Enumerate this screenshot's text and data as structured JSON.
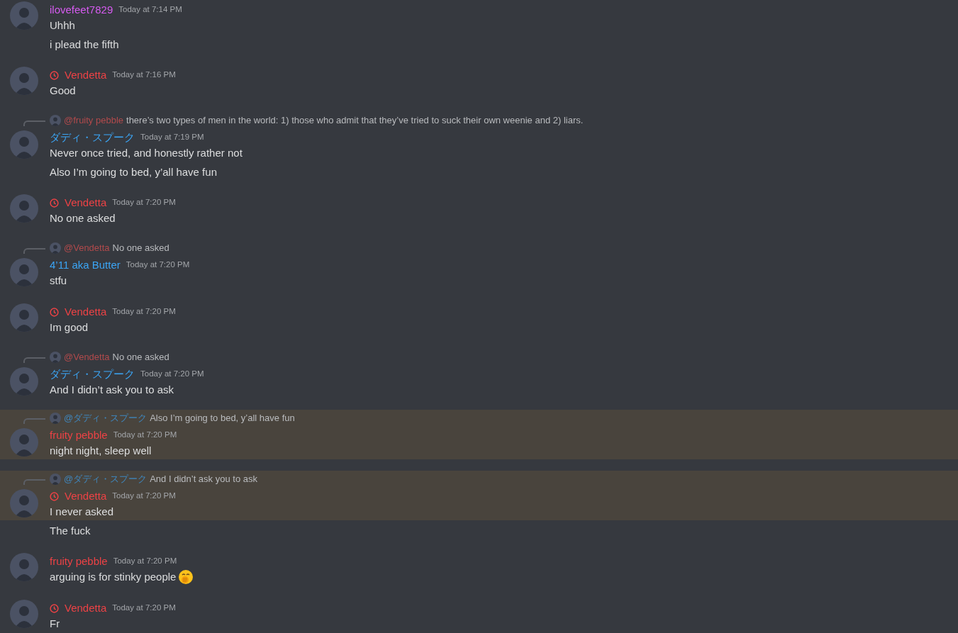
{
  "messages": [
    {
      "author": "ilovefeet7829",
      "color": "#d65bf0",
      "status_icon": false,
      "timestamp": "Today at 7:14 PM",
      "lines": [
        {
          "kind": "text",
          "text": "Uhhh",
          "highlighted": false
        },
        {
          "kind": "text",
          "text": "i plead the fifth",
          "highlighted": false
        }
      ]
    },
    {
      "author": "Vendetta",
      "color": "#ed4245",
      "status_icon": true,
      "timestamp": "Today at 7:16 PM",
      "lines": [
        {
          "kind": "text",
          "text": "Good",
          "highlighted": false
        }
      ]
    },
    {
      "author": "ダディ・スプーク",
      "color": "#3ba5f5",
      "status_icon": false,
      "timestamp": "Today at 7:19 PM",
      "reply": {
        "mention": "@fruity pebble",
        "color": "#b24a4c",
        "text": "there’s two types of men in the world: 1) those who admit that they’ve tried to suck their own weenie and 2) liars."
      },
      "lines": [
        {
          "kind": "text",
          "text": "Never once tried, and honestly rather not",
          "highlighted": false
        },
        {
          "kind": "text",
          "text": "Also I’m going to bed, y’all have fun",
          "highlighted": false
        }
      ]
    },
    {
      "author": "Vendetta",
      "color": "#ed4245",
      "status_icon": true,
      "timestamp": "Today at 7:20 PM",
      "lines": [
        {
          "kind": "text",
          "text": "No one asked",
          "highlighted": false
        }
      ]
    },
    {
      "author": "4’11 aka Butter",
      "color": "#3ba5f5",
      "status_icon": false,
      "timestamp": "Today at 7:20 PM",
      "reply": {
        "mention": "@Vendetta",
        "color": "#b24a4c",
        "text": "No one asked"
      },
      "lines": [
        {
          "kind": "text",
          "text": "stfu",
          "highlighted": false
        }
      ]
    },
    {
      "author": "Vendetta",
      "color": "#ed4245",
      "status_icon": true,
      "timestamp": "Today at 7:20 PM",
      "lines": [
        {
          "kind": "text",
          "text": "Im good",
          "highlighted": false
        }
      ]
    },
    {
      "author": "ダディ・スプーク",
      "color": "#3ba5f5",
      "status_icon": false,
      "timestamp": "Today at 7:20 PM",
      "reply": {
        "mention": "@Vendetta",
        "color": "#b24a4c",
        "text": "No one asked"
      },
      "lines": [
        {
          "kind": "text",
          "text": "And I didn’t ask you to ask",
          "highlighted": false
        }
      ]
    },
    {
      "author": "fruity pebble",
      "color": "#ed4245",
      "status_icon": false,
      "timestamp": "Today at 7:20 PM",
      "reply": {
        "mention": "@ダディ・スプーク",
        "color": "#3f86bd",
        "text": "Also I’m going to bed, y’all have fun"
      },
      "lines": [
        {
          "kind": "text",
          "text": "night night, sleep well",
          "highlighted": true
        }
      ]
    },
    {
      "author": "Vendetta",
      "color": "#ed4245",
      "status_icon": true,
      "timestamp": "Today at 7:20 PM",
      "reply": {
        "mention": "@ダディ・スプーク",
        "color": "#3f86bd",
        "text": "And I didn’t ask you to ask"
      },
      "lines": [
        {
          "kind": "text",
          "text": "I never asked",
          "highlighted": true
        },
        {
          "kind": "text",
          "text": "The fuck",
          "highlighted": false
        }
      ]
    },
    {
      "author": "fruity pebble",
      "color": "#ed4245",
      "status_icon": false,
      "timestamp": "Today at 7:20 PM",
      "lines": [
        {
          "kind": "text-with-emoji",
          "text": "arguing is for stinky people",
          "highlighted": false
        }
      ]
    },
    {
      "author": "Vendetta",
      "color": "#ed4245",
      "status_icon": true,
      "timestamp": "Today at 7:20 PM",
      "lines": [
        {
          "kind": "text",
          "text": "Fr",
          "highlighted": false
        }
      ]
    }
  ]
}
